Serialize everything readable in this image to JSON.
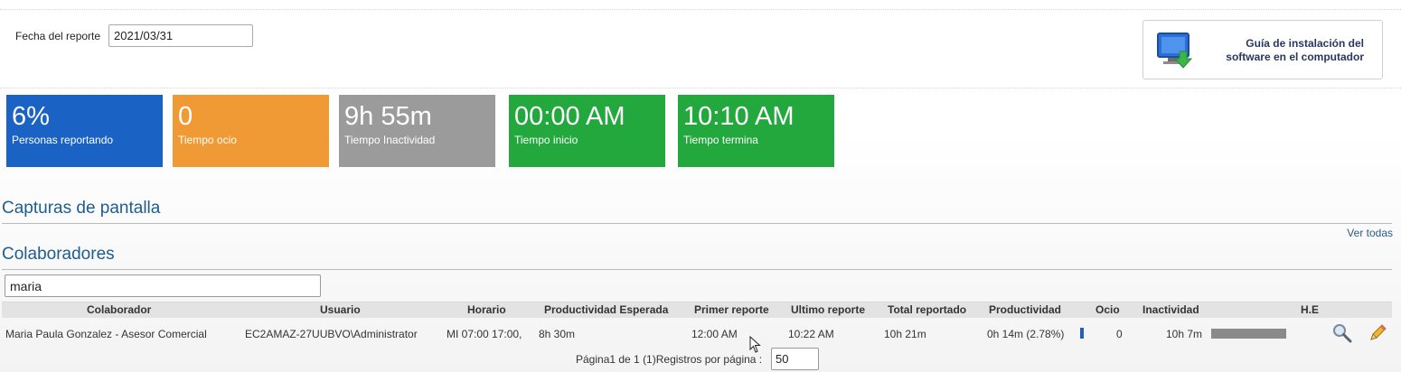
{
  "report": {
    "date_label": "Fecha del reporte",
    "date_value": "2021/03/31"
  },
  "install_guide": {
    "label_line1": "Guía de instalación del",
    "label_line2": "software en el computador"
  },
  "tiles": [
    {
      "value": "6%",
      "label": "Personas reportando",
      "color": "#1a62c4"
    },
    {
      "value": "0",
      "label": "Tiempo ocio",
      "color": "#ef9a35"
    },
    {
      "value": "9h 55m",
      "label": "Tiempo Inactividad",
      "color": "#9b9b9b"
    },
    {
      "value": "00:00 AM",
      "label": "Tiempo inicio",
      "color": "#22a83c"
    },
    {
      "value": "10:10 AM",
      "label": "Tiempo termina",
      "color": "#22a83c"
    }
  ],
  "screenshots": {
    "title": "Capturas de pantalla",
    "see_all": "Ver todas"
  },
  "collaborators": {
    "title": "Colaboradores",
    "search_value": "maria",
    "columns": {
      "colaborador": "Colaborador",
      "usuario": "Usuario",
      "horario": "Horario",
      "productividad_esperada": "Productividad Esperada",
      "primer_reporte": "Primer reporte",
      "ultimo_reporte": "Ultimo reporte",
      "total_reportado": "Total reportado",
      "productividad": "Productividad",
      "ocio": "Ocio",
      "inactividad": "Inactividad",
      "he": "H.E"
    },
    "rows": [
      {
        "colaborador": "Maria Paula Gonzalez - Asesor Comercial",
        "usuario": "EC2AMAZ-27UUBVO\\Administrator",
        "horario": "MI 07:00 17:00,",
        "productividad_esperada": "8h 30m",
        "primer_reporte": "12:00 AM",
        "ultimo_reporte": "10:22 AM",
        "total_reportado": "10h 21m",
        "productividad": "0h 14m (2.78%)",
        "productividad_fraction": 0.0278,
        "ocio": "0",
        "inactividad": "10h 7m"
      }
    ],
    "pager": {
      "text": "Página1 de 1 (1)Registros por página :",
      "per_page": "50"
    }
  }
}
